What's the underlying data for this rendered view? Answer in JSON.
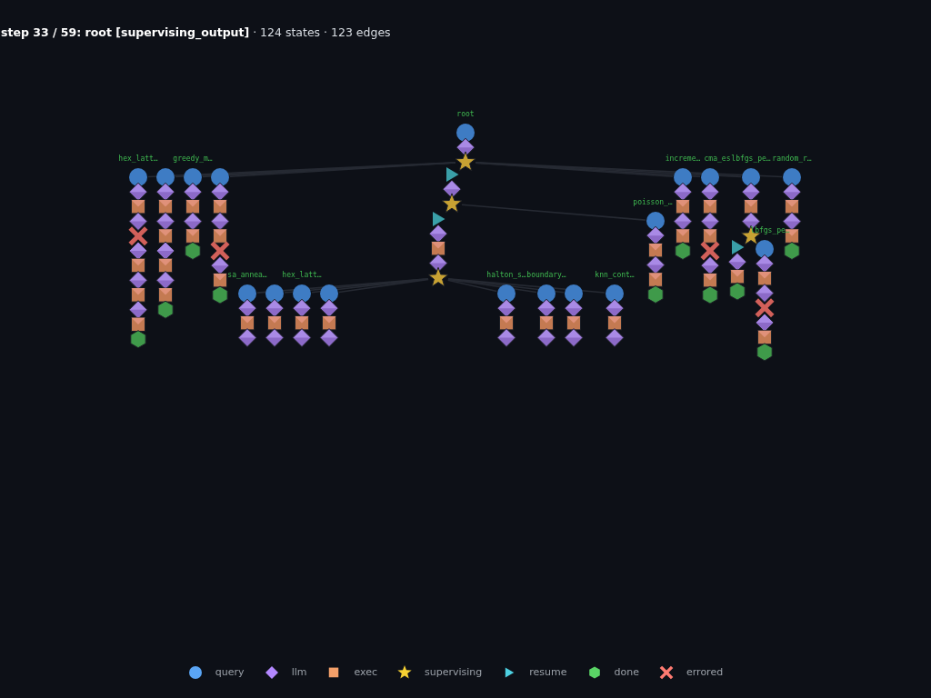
{
  "title": "**step 33 / 59: root [supervising_output]** · 124 states · 123 edges",
  "graph": {
    "root": {
      "label": "root",
      "nodes": [
        {
          "kind": "query"
        },
        {
          "kind": "llm"
        },
        {
          "kind": "supervising"
        }
      ],
      "children": [
        {
          "nodes": [
            {
              "kind": "resume"
            },
            {
              "kind": "llm"
            },
            {
              "kind": "supervising"
            }
          ],
          "children": [
            {
              "nodes": [
                {
                  "kind": "resume"
                },
                {
                  "kind": "llm"
                },
                {
                  "kind": "exec"
                },
                {
                  "kind": "llm"
                },
                {
                  "kind": "supervising"
                }
              ],
              "children": [
                {
                  "label": "sa_annea…",
                  "nodes": [
                    {
                      "kind": "query"
                    },
                    {
                      "kind": "llm"
                    },
                    {
                      "kind": "exec"
                    },
                    {
                      "kind": "llm"
                    }
                  ]
                },
                {
                  "nodes": [
                    {
                      "kind": "query"
                    },
                    {
                      "kind": "llm"
                    },
                    {
                      "kind": "exec"
                    },
                    {
                      "kind": "llm"
                    }
                  ]
                },
                {
                  "label": "hex_latt…",
                  "nodes": [
                    {
                      "kind": "query"
                    },
                    {
                      "kind": "llm"
                    },
                    {
                      "kind": "exec"
                    },
                    {
                      "kind": "llm"
                    }
                  ]
                },
                {
                  "nodes": [
                    {
                      "kind": "query"
                    },
                    {
                      "kind": "llm"
                    },
                    {
                      "kind": "exec"
                    },
                    {
                      "kind": "llm"
                    }
                  ]
                },
                {
                  "label": "halton_s…",
                  "nodes": [
                    {
                      "kind": "query"
                    },
                    {
                      "kind": "llm"
                    },
                    {
                      "kind": "exec"
                    },
                    {
                      "kind": "llm"
                    }
                  ]
                },
                {
                  "label": "boundary…",
                  "nodes": [
                    {
                      "kind": "query"
                    },
                    {
                      "kind": "llm"
                    },
                    {
                      "kind": "exec"
                    },
                    {
                      "kind": "llm"
                    }
                  ]
                },
                {
                  "nodes": [
                    {
                      "kind": "query"
                    },
                    {
                      "kind": "llm"
                    },
                    {
                      "kind": "exec"
                    },
                    {
                      "kind": "llm"
                    }
                  ]
                },
                {
                  "label": "knn_cont…",
                  "nodes": [
                    {
                      "kind": "query"
                    },
                    {
                      "kind": "llm"
                    },
                    {
                      "kind": "exec"
                    },
                    {
                      "kind": "llm"
                    }
                  ]
                }
              ]
            },
            {
              "label": "poisson_…",
              "nodes": [
                {
                  "kind": "query"
                },
                {
                  "kind": "llm"
                },
                {
                  "kind": "exec"
                },
                {
                  "kind": "llm"
                },
                {
                  "kind": "exec"
                },
                {
                  "kind": "done"
                }
              ]
            }
          ]
        },
        {
          "label": "hex_latt…",
          "nodes": [
            {
              "kind": "query"
            },
            {
              "kind": "llm"
            },
            {
              "kind": "exec"
            },
            {
              "kind": "llm"
            },
            {
              "kind": "errored"
            },
            {
              "kind": "llm"
            },
            {
              "kind": "exec"
            },
            {
              "kind": "llm"
            },
            {
              "kind": "exec"
            },
            {
              "kind": "llm"
            },
            {
              "kind": "exec"
            },
            {
              "kind": "done"
            }
          ]
        },
        {
          "nodes": [
            {
              "kind": "query"
            },
            {
              "kind": "llm"
            },
            {
              "kind": "exec"
            },
            {
              "kind": "llm"
            },
            {
              "kind": "exec"
            },
            {
              "kind": "llm"
            },
            {
              "kind": "exec"
            },
            {
              "kind": "llm"
            },
            {
              "kind": "exec"
            },
            {
              "kind": "done"
            }
          ]
        },
        {
          "label": "greedy_m…",
          "nodes": [
            {
              "kind": "query"
            },
            {
              "kind": "llm"
            },
            {
              "kind": "exec"
            },
            {
              "kind": "llm"
            },
            {
              "kind": "exec"
            },
            {
              "kind": "done"
            }
          ]
        },
        {
          "nodes": [
            {
              "kind": "query"
            },
            {
              "kind": "llm"
            },
            {
              "kind": "exec"
            },
            {
              "kind": "llm"
            },
            {
              "kind": "exec"
            },
            {
              "kind": "errored"
            },
            {
              "kind": "llm"
            },
            {
              "kind": "exec"
            },
            {
              "kind": "done"
            }
          ]
        },
        {
          "label": "increme…",
          "nodes": [
            {
              "kind": "query"
            },
            {
              "kind": "llm"
            },
            {
              "kind": "exec"
            },
            {
              "kind": "llm"
            },
            {
              "kind": "exec"
            },
            {
              "kind": "done"
            }
          ]
        },
        {
          "label": "cma_es",
          "nodes": [
            {
              "kind": "query"
            },
            {
              "kind": "llm"
            },
            {
              "kind": "exec"
            },
            {
              "kind": "llm"
            },
            {
              "kind": "exec"
            },
            {
              "kind": "errored"
            },
            {
              "kind": "llm"
            },
            {
              "kind": "exec"
            },
            {
              "kind": "done"
            }
          ]
        },
        {
          "label": "lbfgs_pe…",
          "nodes": [
            {
              "kind": "query"
            },
            {
              "kind": "llm"
            },
            {
              "kind": "exec"
            },
            {
              "kind": "llm"
            },
            {
              "kind": "supervising"
            }
          ],
          "children": [
            {
              "nodes": [
                {
                  "kind": "resume"
                },
                {
                  "kind": "llm"
                },
                {
                  "kind": "exec"
                },
                {
                  "kind": "done"
                }
              ]
            },
            {
              "label": "lbfgs_pe…",
              "nodes": [
                {
                  "kind": "query"
                },
                {
                  "kind": "llm"
                },
                {
                  "kind": "exec"
                },
                {
                  "kind": "llm"
                },
                {
                  "kind": "errored"
                },
                {
                  "kind": "llm"
                },
                {
                  "kind": "exec"
                },
                {
                  "kind": "done"
                }
              ]
            }
          ]
        },
        {
          "label": "random_r…",
          "nodes": [
            {
              "kind": "query"
            },
            {
              "kind": "llm"
            },
            {
              "kind": "exec"
            },
            {
              "kind": "llm"
            },
            {
              "kind": "exec"
            },
            {
              "kind": "done"
            }
          ]
        }
      ]
    }
  },
  "legend": [
    {
      "kind": "query",
      "label": "query"
    },
    {
      "kind": "llm",
      "label": "llm"
    },
    {
      "kind": "exec",
      "label": "exec"
    },
    {
      "kind": "supervising",
      "label": "supervising"
    },
    {
      "kind": "resume",
      "label": "resume"
    },
    {
      "kind": "done",
      "label": "done"
    },
    {
      "kind": "errored",
      "label": "errored"
    }
  ]
}
